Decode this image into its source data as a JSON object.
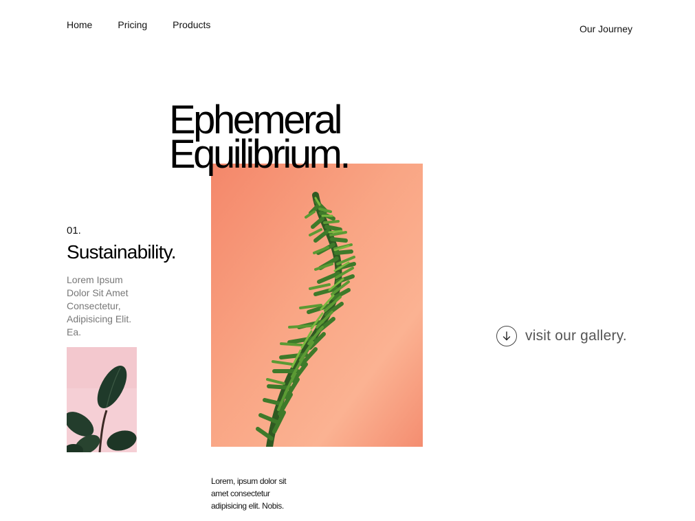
{
  "nav": {
    "items": [
      {
        "label": "Home"
      },
      {
        "label": "Pricing"
      },
      {
        "label": "Products"
      }
    ],
    "right_link": "Our Journey"
  },
  "hero": {
    "title_line1": "Ephemeral",
    "title_line2": "Equilibrium."
  },
  "feature": {
    "number": "01.",
    "title": "Sustainability.",
    "description": "Lorem Ipsum Dolor Sit Amet Consectetur, Adipisicing Elit. Ea."
  },
  "caption": {
    "text": "Lorem, ipsum dolor sit amet consectetur adipisicing elit. Nobis."
  },
  "gallery": {
    "label": "visit our gallery.",
    "icon": "arrow-down-circle-icon"
  },
  "colors": {
    "main_image_bg": "#f8a07d",
    "small_image_bg": "#f5cdd3",
    "plant_green": "#3f7a2c"
  }
}
